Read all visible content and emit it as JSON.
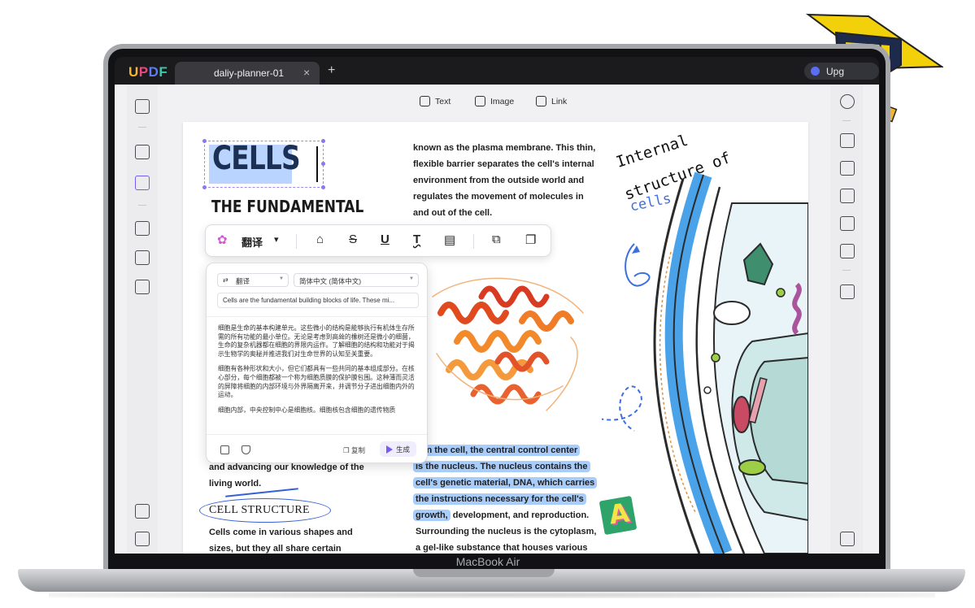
{
  "app": {
    "logo": [
      "U",
      "P",
      "D",
      "F"
    ],
    "tab_title": "daliy-planner-01",
    "tab_close": "×",
    "tab_add": "+",
    "upgrade_label": "Upg"
  },
  "device": {
    "label": "MacBook Air"
  },
  "topbar": {
    "text": "Text",
    "image": "Image",
    "link": "Link"
  },
  "document": {
    "title": "CELLS",
    "subtitle": "THE FUNDAMENTAL",
    "col2_top": [
      "known as the plasma membrane. This thin,",
      "flexible barrier separates the cell's internal",
      "environment from the outside world and",
      "regulates the movement of molecules in",
      "and out of the cell."
    ],
    "col1_bottom": [
      "and advancing our knowledge of the",
      "living world."
    ],
    "section_heading": "CELL STRUCTURE",
    "col1_section": [
      "Cells come in various shapes and",
      "sizes, but they all share certain"
    ],
    "col2_bottom_highlight": [
      "thin the cell, the central control center",
      "is the nucleus. The nucleus contains the",
      "cell's genetic material, DNA, which carries",
      "the instructions necessary for the cell's",
      "growth,"
    ],
    "col2_bottom_rest": " development, and reproduction.",
    "col2_bottom_tail": [
      "Surrounding the nucleus is the cytoplasm,",
      "a gel-like substance that houses various"
    ],
    "handwritten_title_line1": "Internal",
    "handwritten_title_line2": "structure of",
    "handwritten_cells": "cells",
    "sticker_letter": "A"
  },
  "toolbar_popup": {
    "translate_label": "翻译",
    "dropdown_arrow": "▾"
  },
  "translate_panel": {
    "mode_label": "翻译",
    "language": "简体中文 (简体中文)",
    "source_text": "Cells are the fundamental building  blocks of life. These mi...",
    "output_paragraphs": [
      "细胞是生命的基本构建单元。这些微小的结构是能够执行有机体生存所需的所有功能的最小单位。无论是考虑到高耸的橡树还是微小的细菌，生命的复杂机器都在细胞的界限内运作。了解细胞的结构和功能对于揭示生物学的奥秘并推进我们对生命世界的认知至关重要。",
      "细胞有各种形状和大小，但它们都具有一些共同的基本组成部分。在核心部分，每个细胞都被一个称为细胞质膜的保护膜包围。这种薄而灵活的屏障将细胞的内部环境与外界隔离开来，并调节分子进出细胞内外的运动。",
      "细胞内部，中央控制中心是细胞核。细胞核包含细胞的遗传物质"
    ],
    "copy_label": "复制",
    "generate_label": "生成"
  },
  "colors": {
    "accent": "#6f60f2",
    "highlight": "#a9cdfb",
    "title_navy": "#1c2f55",
    "annotation_blue": "#3561d6"
  }
}
